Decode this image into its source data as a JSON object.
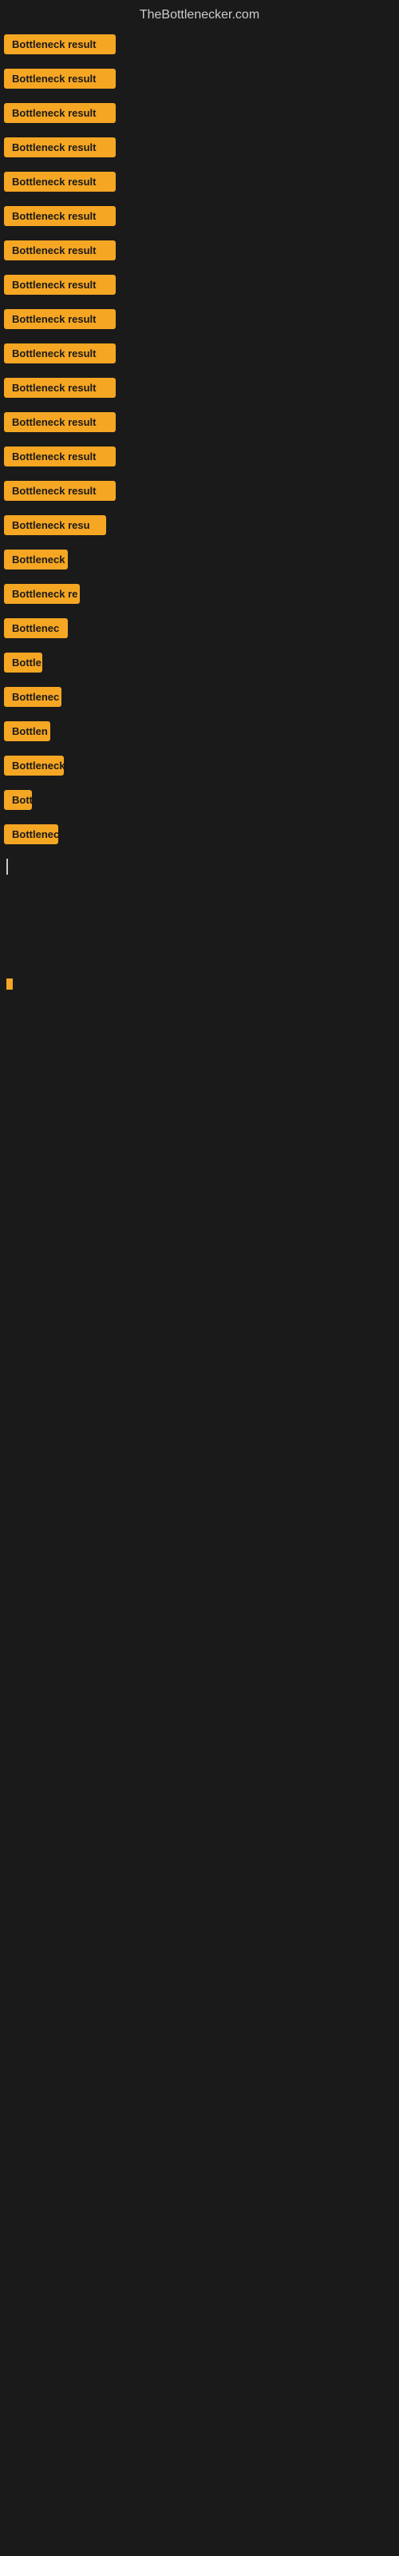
{
  "site": {
    "title": "TheBottlenecker.com"
  },
  "items": [
    {
      "id": 1,
      "label": "Bottleneck result",
      "type": "full"
    },
    {
      "id": 2,
      "label": "Bottleneck result",
      "type": "full"
    },
    {
      "id": 3,
      "label": "Bottleneck result",
      "type": "full"
    },
    {
      "id": 4,
      "label": "Bottleneck result",
      "type": "full"
    },
    {
      "id": 5,
      "label": "Bottleneck result",
      "type": "full"
    },
    {
      "id": 6,
      "label": "Bottleneck result",
      "type": "full"
    },
    {
      "id": 7,
      "label": "Bottleneck result",
      "type": "full"
    },
    {
      "id": 8,
      "label": "Bottleneck result",
      "type": "full"
    },
    {
      "id": 9,
      "label": "Bottleneck result",
      "type": "full"
    },
    {
      "id": 10,
      "label": "Bottleneck result",
      "type": "full"
    },
    {
      "id": 11,
      "label": "Bottleneck result",
      "type": "full"
    },
    {
      "id": 12,
      "label": "Bottleneck result",
      "type": "full"
    },
    {
      "id": 13,
      "label": "Bottleneck result",
      "type": "full"
    },
    {
      "id": 14,
      "label": "Bottleneck result",
      "type": "full"
    },
    {
      "id": 15,
      "label": "Bottleneck resu",
      "type": "partial1"
    },
    {
      "id": 16,
      "label": "Bottleneck",
      "type": "partial2"
    },
    {
      "id": 17,
      "label": "Bottleneck re",
      "type": "partial3"
    },
    {
      "id": 18,
      "label": "Bottlenec",
      "type": "partial2"
    },
    {
      "id": 19,
      "label": "Bottle",
      "type": "partial4"
    },
    {
      "id": 20,
      "label": "Bottlenec",
      "type": "partial2"
    },
    {
      "id": 21,
      "label": "Bottlen",
      "type": "partial5"
    },
    {
      "id": 22,
      "label": "Bottleneck",
      "type": "partial2"
    },
    {
      "id": 23,
      "label": "Bott",
      "type": "partial9"
    },
    {
      "id": 24,
      "label": "Bottlenec",
      "type": "partial10"
    }
  ],
  "colors": {
    "badge_bg": "#f5a623",
    "badge_text": "#1a1a1a",
    "background": "#1a1a1a",
    "title": "#cccccc"
  }
}
